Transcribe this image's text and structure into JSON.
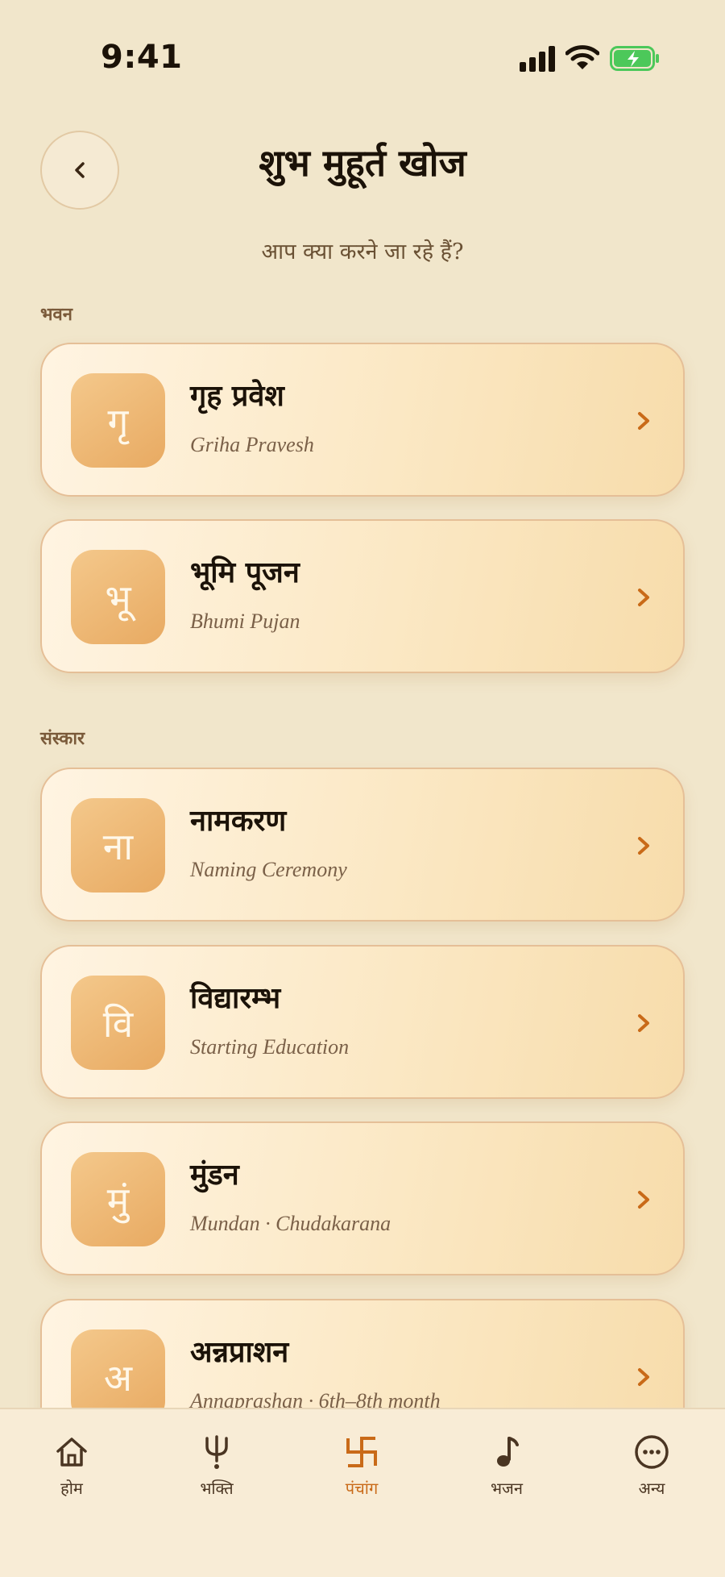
{
  "status": {
    "time": "9:41"
  },
  "header": {
    "title": "शुभ मुहूर्त खोज",
    "subtitle": "आप क्या करने जा रहे हैं?"
  },
  "sections": [
    {
      "label": "भवन",
      "items": [
        {
          "glyph": "गृ",
          "title": "गृह प्रवेश",
          "subtitle": "Griha Pravesh"
        },
        {
          "glyph": "भू",
          "title": "भूमि पूजन",
          "subtitle": "Bhumi Pujan"
        }
      ]
    },
    {
      "label": "संस्कार",
      "items": [
        {
          "glyph": "ना",
          "title": "नामकरण",
          "subtitle": "Naming Ceremony"
        },
        {
          "glyph": "वि",
          "title": "विद्यारम्भ",
          "subtitle": "Starting Education"
        },
        {
          "glyph": "मुं",
          "title": "मुंडन",
          "subtitle": "Mundan · Chudakarana"
        },
        {
          "glyph": "अ",
          "title": "अन्नप्राशन",
          "subtitle": "Annaprashan · 6th–8th month"
        }
      ]
    }
  ],
  "tabbar": {
    "tabs": [
      {
        "label": "होम",
        "icon": "home-icon"
      },
      {
        "label": "भक्ति",
        "icon": "trishul-icon"
      },
      {
        "label": "पंचांग",
        "icon": "swastika-icon",
        "active": true
      },
      {
        "label": "भजन",
        "icon": "music-note-icon"
      },
      {
        "label": "अन्य",
        "icon": "more-icon"
      }
    ]
  },
  "colors": {
    "accent": "#c96a18",
    "background": "#f1e6cb",
    "battery": "#4cc85a"
  }
}
